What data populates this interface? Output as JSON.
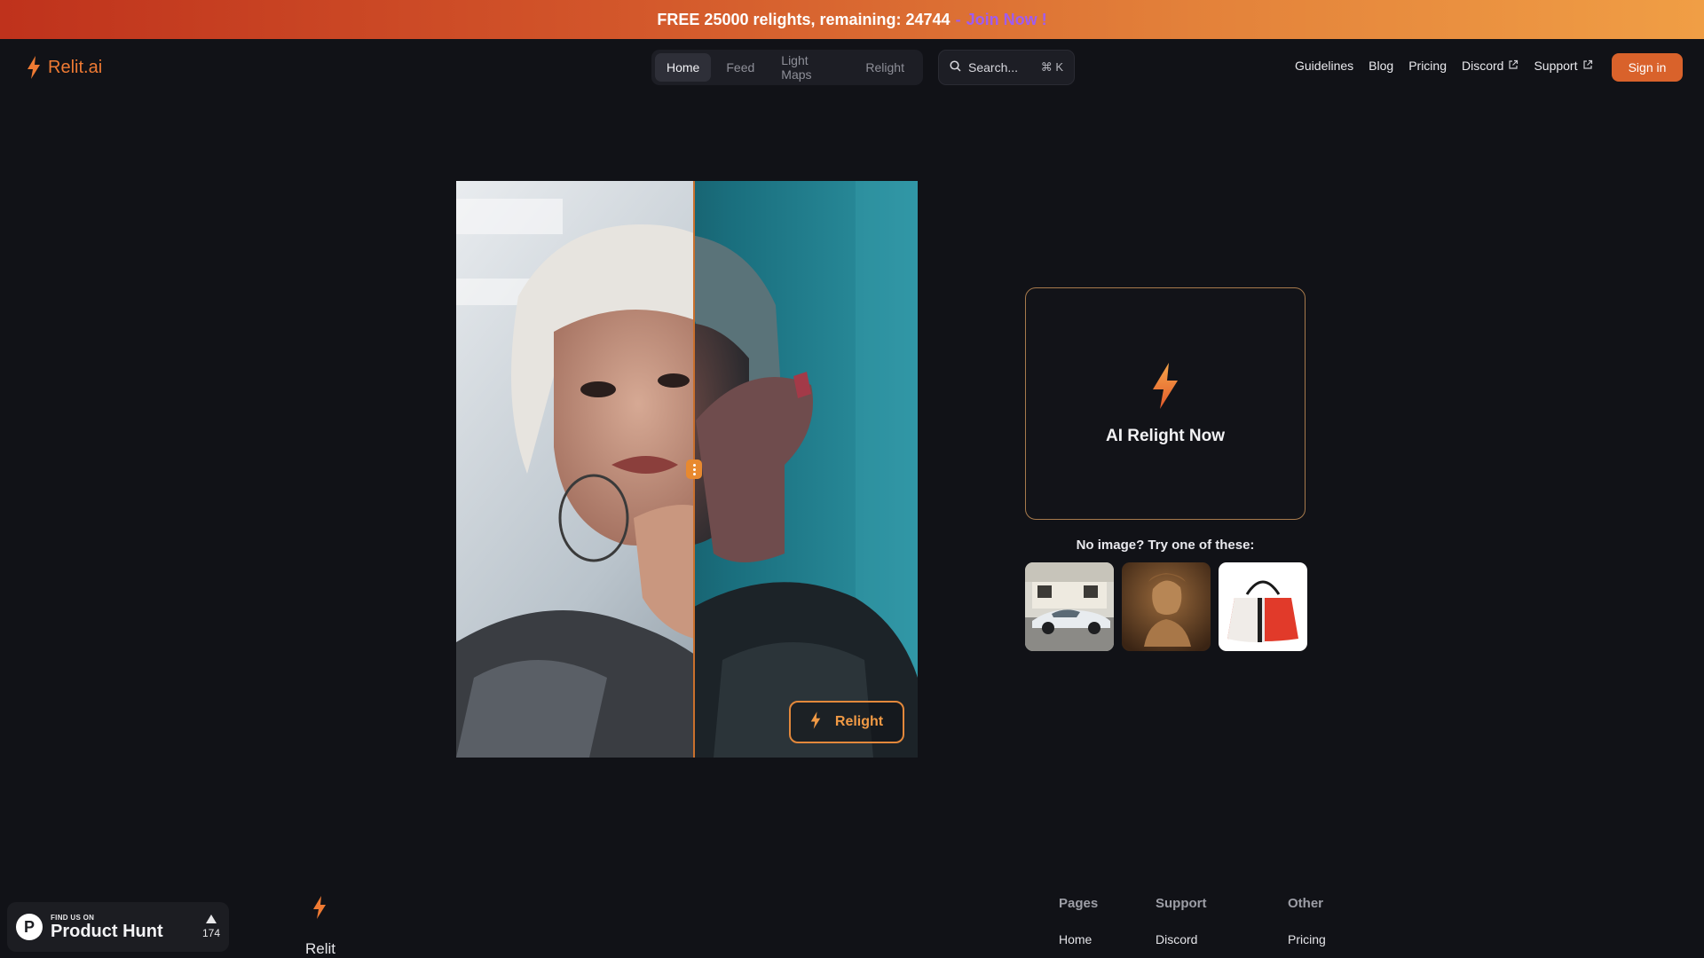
{
  "banner": {
    "text": "FREE 25000 relights, remaining: 24744",
    "dash": "-",
    "join": "Join Now !"
  },
  "brand": {
    "name": "Relit.ai",
    "accent": "#ef7a33"
  },
  "nav": {
    "tabs": [
      {
        "label": "Home",
        "active": true
      },
      {
        "label": "Feed"
      },
      {
        "label": "Light Maps"
      },
      {
        "label": "Relight"
      }
    ],
    "search": {
      "placeholder": "Search...",
      "shortcut": "⌘ K"
    },
    "links": [
      {
        "label": "Guidelines"
      },
      {
        "label": "Blog"
      },
      {
        "label": "Pricing"
      },
      {
        "label": "Discord",
        "external": true
      },
      {
        "label": "Support",
        "external": true
      }
    ],
    "signin": "Sign in"
  },
  "hero": {
    "relight_button": "Relight",
    "upload_title": "AI Relight Now",
    "try_label": "No image? Try one of these:",
    "samples": [
      {
        "icon": "sports-car-image"
      },
      {
        "icon": "statue-bust-image"
      },
      {
        "icon": "handbag-image"
      }
    ]
  },
  "footer": {
    "brand": "Relit",
    "columns": [
      {
        "title": "Pages",
        "first_link": "Home"
      },
      {
        "title": "Support",
        "first_link": "Discord"
      },
      {
        "title": "Other",
        "first_link": "Pricing"
      }
    ]
  },
  "product_hunt": {
    "small": "FIND US ON",
    "big": "Product Hunt",
    "votes": "174"
  }
}
